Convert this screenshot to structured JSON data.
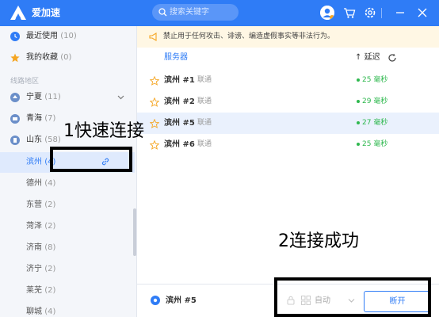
{
  "app": {
    "title": "爱加速"
  },
  "search": {
    "placeholder": "搜索关键字"
  },
  "sidebar": {
    "recent": {
      "label": "最近使用",
      "count": "(10)"
    },
    "favorites": {
      "label": "我的收藏",
      "count": "(0)"
    },
    "section_title": "线路地区",
    "regions": [
      {
        "label": "宁夏",
        "count": "(11)"
      },
      {
        "label": "青海",
        "count": "(7)"
      },
      {
        "label": "山东",
        "count": "(58)"
      }
    ],
    "cities": [
      {
        "label": "滨州",
        "count": "(4)"
      },
      {
        "label": "德州",
        "count": "(4)"
      },
      {
        "label": "东营",
        "count": "(2)"
      },
      {
        "label": "菏泽",
        "count": "(2)"
      },
      {
        "label": "济南",
        "count": "(8)"
      },
      {
        "label": "济宁",
        "count": "(2)"
      },
      {
        "label": "莱芜",
        "count": "(2)"
      },
      {
        "label": "聊城",
        "count": "(4)"
      }
    ]
  },
  "notice": {
    "text": "禁止用于任何攻击、诽谤、编造虚假事实等非法行为。"
  },
  "table": {
    "col_server": "服务器",
    "col_latency": "延迟",
    "sort_arrow": "↑",
    "rows": [
      {
        "name": "滨州 #1",
        "isp": "联通",
        "latency": "25 毫秒"
      },
      {
        "name": "滨州 #2",
        "isp": "联通",
        "latency": "29 毫秒"
      },
      {
        "name": "滨州 #5",
        "isp": "联通",
        "latency": "27 毫秒"
      },
      {
        "name": "滨州 #6",
        "isp": "联通",
        "latency": "25 毫秒"
      }
    ]
  },
  "bottom": {
    "current": "滨州 #5",
    "mode": "自动",
    "disconnect": "断开"
  },
  "annotations": {
    "step1": "1快速连接",
    "step2": "2连接成功"
  },
  "colors": {
    "accent": "#2f7cf6",
    "latency_good": "#2fb84f",
    "notice_bg": "#fff7e4"
  }
}
